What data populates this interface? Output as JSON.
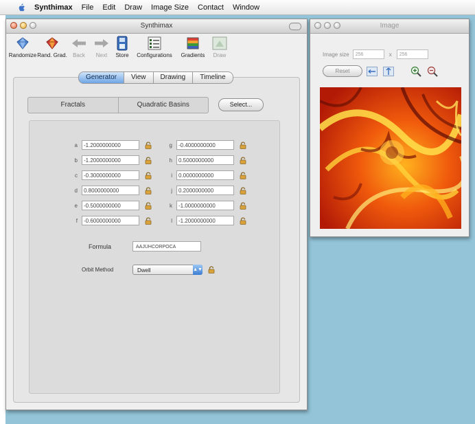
{
  "menubar": {
    "app_name": "Synthimax",
    "items": [
      "File",
      "Edit",
      "Draw",
      "Image Size",
      "Contact",
      "Window"
    ]
  },
  "main_window": {
    "title": "Synthimax",
    "toolbar": [
      {
        "label": "Randomize",
        "icon": "gem-icon",
        "enabled": true
      },
      {
        "label": "Rand. Grad.",
        "icon": "gradient-gem-icon",
        "enabled": true
      },
      {
        "label": "Back",
        "icon": "back-arrow-icon",
        "enabled": false
      },
      {
        "label": "Next",
        "icon": "next-arrow-icon",
        "enabled": false
      },
      {
        "label": "Store",
        "icon": "store-icon",
        "enabled": true
      },
      {
        "label": "Configurations",
        "icon": "configurations-icon",
        "enabled": true
      },
      {
        "label": "Gradients",
        "icon": "gradients-icon",
        "enabled": true
      },
      {
        "label": "Draw",
        "icon": "draw-icon",
        "enabled": false
      }
    ],
    "tabs": [
      {
        "label": "Generator",
        "active": true
      },
      {
        "label": "View",
        "active": false
      },
      {
        "label": "Drawing",
        "active": false
      },
      {
        "label": "Timeline",
        "active": false
      }
    ],
    "segments": [
      "Fractals",
      "Quadratic Basins"
    ],
    "select_button": "Select...",
    "params_left": [
      {
        "label": "a",
        "value": "-1.2000000000"
      },
      {
        "label": "b",
        "value": "-1.2000000000"
      },
      {
        "label": "c",
        "value": "-0.3000000000"
      },
      {
        "label": "d",
        "value": "0.8000000000"
      },
      {
        "label": "e",
        "value": "-0.5000000000"
      },
      {
        "label": "f",
        "value": "-0.6000000000"
      }
    ],
    "params_right": [
      {
        "label": "g",
        "value": "-0.4000000000"
      },
      {
        "label": "h",
        "value": "0.5000000000"
      },
      {
        "label": "i",
        "value": "0.0000000000"
      },
      {
        "label": "j",
        "value": "0.2000000000"
      },
      {
        "label": "k",
        "value": "-1.0000000000"
      },
      {
        "label": "l",
        "value": "-1.2000000000"
      }
    ],
    "formula_label": "Formula",
    "formula_value": "AAJUHCORPOCA",
    "orbit_label": "Orbit Method",
    "orbit_value": "Dwell",
    "orbit_arrow": "▲▼"
  },
  "image_window": {
    "title": "Image",
    "size_label": "Image size",
    "width": "256",
    "height": "256",
    "times": "x",
    "reset_button": "Reset"
  },
  "colors": {
    "desktop": "#93c4d8",
    "accent": "#6ea5e4"
  }
}
